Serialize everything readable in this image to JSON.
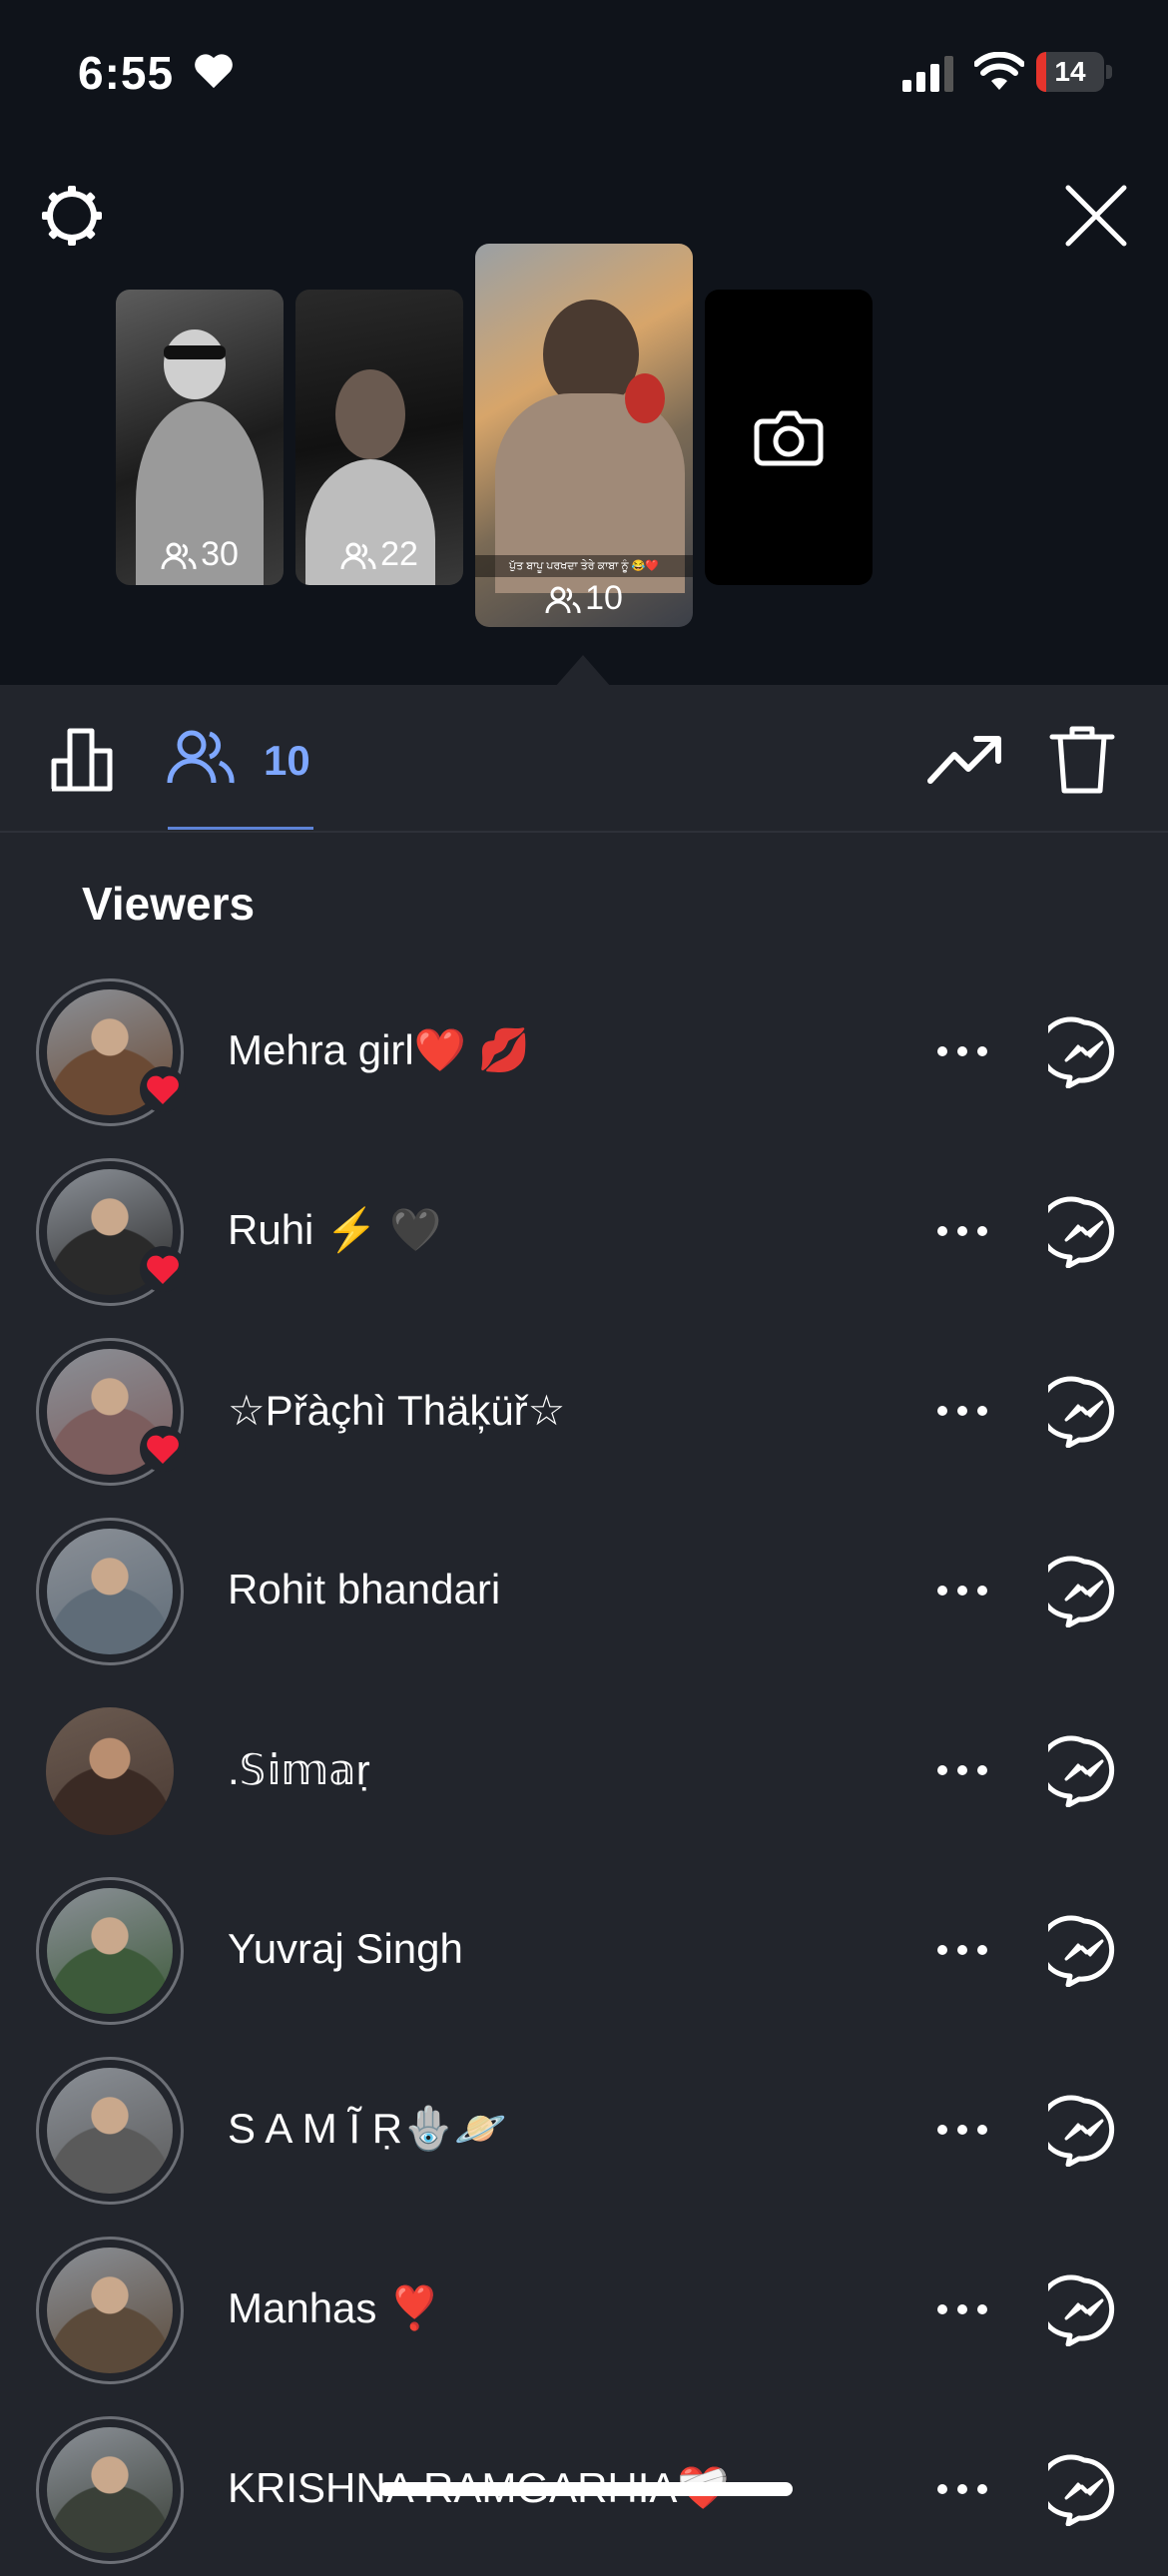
{
  "status_bar": {
    "time": "6:55",
    "battery": "14",
    "battery_fraction": 0.14
  },
  "stories": [
    {
      "views": "30"
    },
    {
      "views": "22"
    },
    {
      "views": "10",
      "caption": "ਪੁੱਤ ਬਾਪੂ ਪਰਖਦਾ ਤੇਰੇ ਕਾਬਾ ਨੂੰ 😂❤️"
    }
  ],
  "toolbar": {
    "viewers_count": "10"
  },
  "viewers_heading": "Viewers",
  "viewers": [
    {
      "name": "Mehra girl❤️ 💋",
      "liked": true,
      "avatar_color": "#6b4a34"
    },
    {
      "name": "Ruhi ⚡ 🖤",
      "liked": true,
      "avatar_color": "#2a2a2a"
    },
    {
      "name": "☆Přàçhì Thäķüř☆",
      "liked": true,
      "avatar_color": "#7c5d5d"
    },
    {
      "name": "Rohit bhandari",
      "liked": false,
      "avatar_color": "#5f6c78"
    },
    {
      "name": ".𝕊𝕚𝕞𝕒ṛ",
      "liked": false,
      "avatar_color": "#4a3a33"
    },
    {
      "name": "Yuvraj Singh",
      "liked": false,
      "avatar_color": "#3d5a3a"
    },
    {
      "name": "S A M Ĩ Ṛ🪬🪐",
      "liked": false,
      "avatar_color": "#5a5a5a"
    },
    {
      "name": "Manhas ❣️",
      "liked": false,
      "avatar_color": "#5b4a3a"
    },
    {
      "name": "KRISHNA RAMGARHIA❤️‍🩹",
      "liked": false,
      "avatar_color": "#3a4038"
    }
  ],
  "colors": {
    "accent": "#7ea7ff",
    "like_red": "#f2213b",
    "background": "#22252c",
    "top_background": "#0f131a"
  },
  "icons": [
    "settings-icon",
    "close-icon",
    "camera-icon",
    "bar-chart-icon",
    "people-icon",
    "trending-up-icon",
    "trash-icon",
    "more-horizontal-icon",
    "messenger-icon",
    "heart-icon"
  ]
}
